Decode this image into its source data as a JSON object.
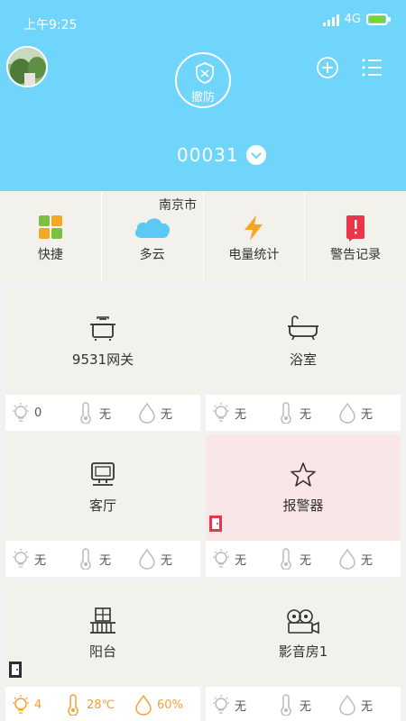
{
  "status_bar": {
    "time": "上午9:25",
    "network": "4G"
  },
  "header": {
    "disarm_label": "撤防",
    "device_id": "00031"
  },
  "quick": [
    {
      "label": "快捷",
      "icon": "grid-icon"
    },
    {
      "label": "多云",
      "icon": "cloud-icon",
      "city": "南京市"
    },
    {
      "label": "电量统计",
      "icon": "lightning-icon"
    },
    {
      "label": "警告记录",
      "icon": "alert-icon"
    }
  ],
  "rooms": [
    {
      "name": "9531网关",
      "icon": "pot-icon",
      "light": "0",
      "temp": "无",
      "humidity": "无"
    },
    {
      "name": "浴室",
      "icon": "bathtub-icon",
      "light": "无",
      "temp": "无",
      "humidity": "无"
    },
    {
      "name": "客厅",
      "icon": "tv-icon",
      "light": "无",
      "temp": "无",
      "humidity": "无"
    },
    {
      "name": "报警器",
      "icon": "star-icon",
      "light": "无",
      "temp": "无",
      "humidity": "无"
    },
    {
      "name": "阳台",
      "icon": "balcony-icon",
      "light": "4",
      "temp": "28℃",
      "humidity": "60%"
    },
    {
      "name": "影音房1",
      "icon": "film-camera-icon",
      "light": "无",
      "temp": "无",
      "humidity": "无"
    }
  ],
  "colors": {
    "header_bg": "#6fd5fb",
    "alarm_bg": "#f9e6e6",
    "warm_stat": "#f5a033",
    "door_red": "#e8374b"
  }
}
